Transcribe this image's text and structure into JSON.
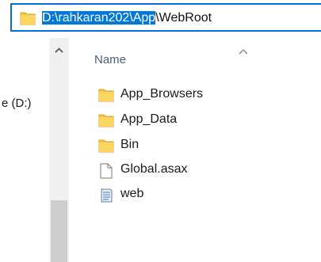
{
  "address_bar": {
    "path_selected": "D:\\rahkaran202\\App",
    "path_rest": "\\WebRoot"
  },
  "nav_pane": {
    "drive_label": "e (D:)"
  },
  "file_list": {
    "column_header": "Name",
    "sort": "ascending",
    "items": [
      {
        "name": "App_Browsers",
        "icon": "folder-icon"
      },
      {
        "name": "App_Data",
        "icon": "folder-icon"
      },
      {
        "name": "Bin",
        "icon": "folder-icon"
      },
      {
        "name": "Global.asax",
        "icon": "file-icon"
      },
      {
        "name": "web",
        "icon": "config-file-icon"
      }
    ]
  },
  "colors": {
    "selection": "#0078d7",
    "focus_border": "#0a6cce",
    "folder": "#f5c342",
    "header_text": "#4c607a"
  }
}
